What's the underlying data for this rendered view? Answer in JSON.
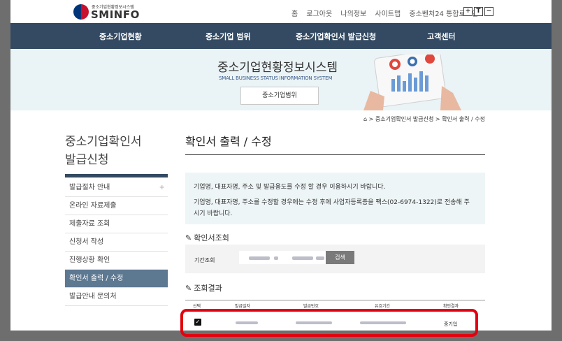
{
  "header": {
    "logo_small": "중소기업현황정보시스템",
    "logo_main": "SMINFO",
    "util_links": [
      "홈",
      "로그아웃",
      "나의정보",
      "사이트맵",
      "중소벤처24 통합로그인"
    ],
    "font_buttons": [
      "+",
      "T",
      "−"
    ]
  },
  "gnb": {
    "items": [
      "중소기업현황",
      "중소기업 범위",
      "중소기업확인서 발급신청",
      "고객센터"
    ]
  },
  "hero": {
    "title": "중소기업현황정보시스템",
    "subtitle": "SMALL BUSINESS STATUS INFORMATION SYSTEM",
    "button": "중소기업범위"
  },
  "breadcrumb": {
    "items": [
      "중소기업확인서 발급신청",
      "확인서 출력 / 수정"
    ]
  },
  "sidebar": {
    "title_line1": "중소기업확인서",
    "title_line2": "발급신청",
    "items": [
      {
        "label": "발급절차 안내",
        "plus": "+"
      },
      {
        "label": "온라인 자료제출"
      },
      {
        "label": "제출자료 조회"
      },
      {
        "label": "신청서 작성"
      },
      {
        "label": "진행상황 확인"
      },
      {
        "label": "확인서 출력 / 수정"
      },
      {
        "label": "발급안내 문의처"
      }
    ]
  },
  "main": {
    "title": "확인서 출력 / 수정",
    "notice_line1": "기업명, 대표자명, 주소 및 발급용도를 수정 할 경우 이용하시기 바랍니다.",
    "notice_line2": "기업명, 대표자명, 주소를 수정할 경우에는 수정 후에 사업자등록증을 팩스(02-6974-1322)로 전송해 주",
    "notice_line3": "시기 바랍니다.",
    "search_section": "확인서조회",
    "search_label": "기간조회",
    "search_button": "검색",
    "result_section": "조회결과",
    "table_headers": [
      "선택",
      "발급일자",
      "발급번호",
      "유효기간",
      "확인결과"
    ],
    "row": {
      "checked": true,
      "result": "중기업"
    }
  },
  "colors": {
    "gnb_bg": "#334a62",
    "active_side": "#5d7891",
    "highlight": "#e3000f"
  }
}
